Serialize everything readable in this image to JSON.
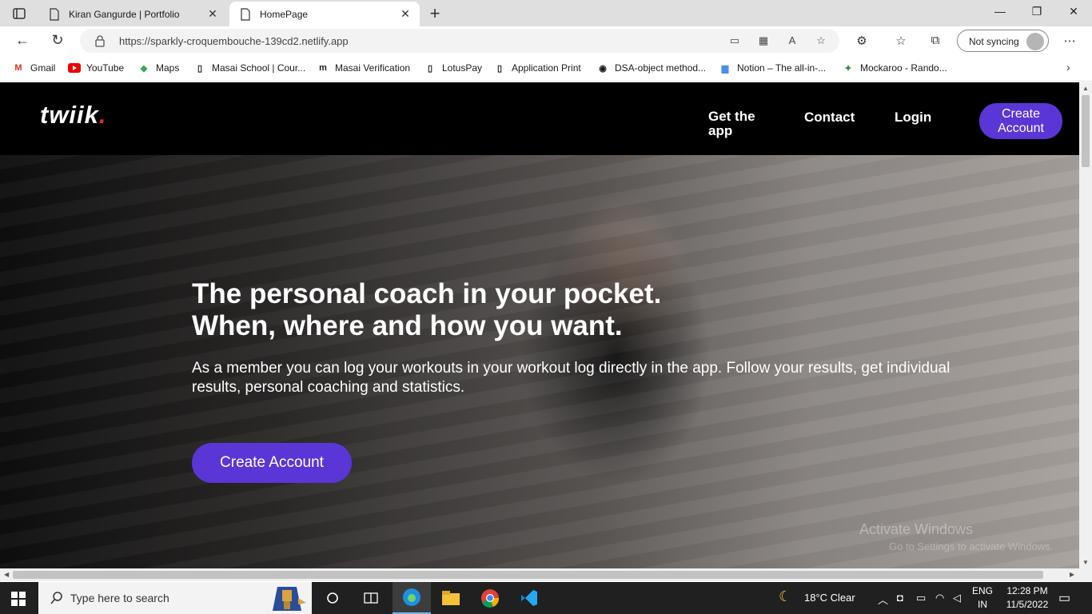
{
  "browser": {
    "tabs": [
      {
        "title": "Kiran Gangurde | Portfolio",
        "close": "✕"
      },
      {
        "title": "HomePage",
        "close": "✕"
      }
    ],
    "new_tab": "+",
    "window_controls": {
      "minimize": "—",
      "restore": "❐",
      "close": "✕"
    },
    "url": "https://sparkly-croquembouche-139cd2.netlify.app",
    "profile_label": "Not syncing",
    "bookmarks": [
      "Gmail",
      "YouTube",
      "Maps",
      "Masai School | Cour...",
      "Masai Verification",
      "LotusPay",
      "Application Print",
      "DSA-object method...",
      "Notion – The all-in-...",
      "Mockaroo - Rando..."
    ],
    "bookmarks_more": "›"
  },
  "site": {
    "logo": "twiik",
    "logo_dot": ".",
    "nav": {
      "get_app_line1": "Get the",
      "get_app_line2": "app",
      "contact": "Contact",
      "login": "Login",
      "create_line1": "Create",
      "create_line2": "Account"
    },
    "hero": {
      "headline_line1": "The personal coach in your pocket.",
      "headline_line2": "When, where and how you want.",
      "body": "As a member you can log your workouts in your workout log directly in the app. Follow your results, get individual results, personal coaching and statistics.",
      "cta": "Create Account"
    },
    "watermark": {
      "line1": "Activate Windows",
      "line2": "Go to Settings to activate Windows."
    }
  },
  "taskbar": {
    "search_placeholder": "Type here to search",
    "weather": "18°C  Clear",
    "lang_line1": "ENG",
    "lang_line2": "IN",
    "time": "12:28 PM",
    "date": "11/5/2022"
  },
  "colors": {
    "accent": "#5b36d6",
    "logo_dot": "#e02929",
    "nav_bg": "#000000"
  }
}
